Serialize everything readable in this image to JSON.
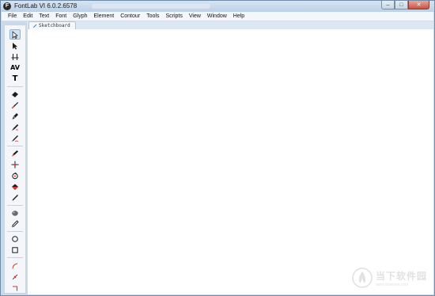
{
  "window": {
    "title": "FontLab VI 6.0.2.6578",
    "app_icon_letter": "F",
    "controls": {
      "minimize": "–",
      "maximize": "□",
      "close": "✕"
    }
  },
  "menu": {
    "items": [
      "File",
      "Edit",
      "Text",
      "Font",
      "Glyph",
      "Element",
      "Contour",
      "Tools",
      "Scripts",
      "View",
      "Window",
      "Help"
    ]
  },
  "tabs": [
    {
      "label": "Sketchboard",
      "icon": "pen-icon"
    }
  ],
  "tools": [
    {
      "name": "contour-select-tool-icon",
      "selected": true
    },
    {
      "name": "element-select-tool-icon",
      "selected": false
    },
    {
      "name": "metrics-tool-icon",
      "selected": false
    },
    {
      "name": "kerning-tool-icon",
      "glyph": "AV"
    },
    {
      "name": "text-tool-icon",
      "glyph": "T"
    },
    {
      "name": "eraser-tool-icon"
    },
    {
      "name": "brush-tool-icon"
    },
    {
      "name": "fountain-pen-tool-icon"
    },
    {
      "name": "calligraphy-pen-tool-icon"
    },
    {
      "name": "pencil-tool-icon"
    },
    {
      "name": "knife-tool-icon"
    },
    {
      "name": "rapidograph-tool-icon"
    },
    {
      "name": "fill-tool-icon"
    },
    {
      "name": "paint-bucket-tool-icon"
    },
    {
      "name": "marker-tool-icon"
    },
    {
      "name": "hand-tool-icon"
    },
    {
      "name": "eyedropper-tool-icon"
    },
    {
      "name": "ellipse-tool-icon"
    },
    {
      "name": "rectangle-tool-icon"
    },
    {
      "name": "corner-tool-icon"
    },
    {
      "name": "node-tool-icon"
    },
    {
      "name": "angle-tool-icon"
    }
  ],
  "watermark": {
    "cn": "当下软件园",
    "url": "www.downxia.com"
  },
  "colors": {
    "frame": "#c9daec",
    "selected_tool": "#cfe3f7",
    "tool_red": "#d23a2a"
  }
}
